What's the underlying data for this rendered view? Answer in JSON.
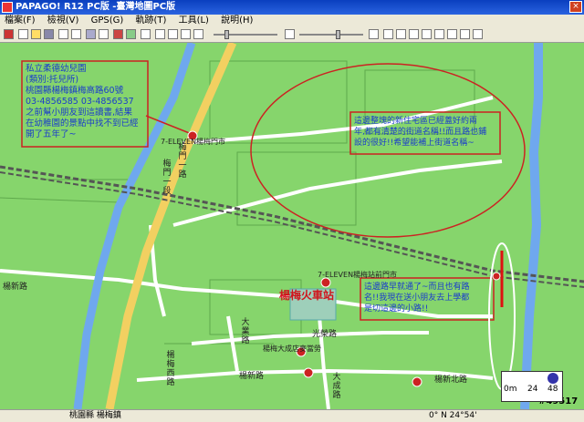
{
  "window": {
    "title": "PAPAGO! R12 PC版 -臺灣地圖PC版",
    "close_glyph": "×"
  },
  "menu": [
    "檔案(F)",
    "檢視(V)",
    "GPS(G)",
    "軌跡(T)",
    "工具(L)",
    "說明(H)"
  ],
  "map": {
    "roads": {
      "meimen_1": "梅門一路",
      "meimen_1_south": "梅門一段",
      "yangxin_road": "楊新路",
      "yangxin_north": "楊新北路",
      "da_cheng": "大成路",
      "guang_rong": "光榮路",
      "da_ye": "大業路",
      "yangmei_xizhou": "楊梅西路",
      "rail_road": "楊梅火車站"
    },
    "pois": {
      "seven_eleven_top": "7-ELEVEN楊梅門市",
      "seven_eleven_mid": "7-ELEVEN楊梅站前門市",
      "hotel": "楊梅大成店麥當勞",
      "station_title": "楊梅火車站"
    },
    "annotations": {
      "kindergarten": [
        "私立柔德幼兒園",
        "(類別:托兒所)",
        "桃園縣楊梅鎮梅高路60號",
        "03-4856585      03-4856537",
        "之前幫小朋友到這讀書,結果",
        "在幼稚園的景點中找不到已經",
        "開了五年了~"
      ],
      "new_homes": [
        "這邊整塊的新住宅區已經蓋好約兩",
        "年,都有清楚的街道名稱!!而且路也鋪",
        "設的很好!!希望能補上街道名稱~"
      ],
      "small_road": [
        "這邊路早就通了~而且也有路",
        "名!!我現在送小朋友去上學都",
        "是切這邊的小路!!"
      ]
    },
    "scale": {
      "left": "0m",
      "mid": "24",
      "right": "48"
    },
    "watermark": "#49517"
  },
  "status": {
    "address": "桃園縣 楊梅鎮",
    "coords": "0°  N 24°54'"
  },
  "colors": {
    "map_bg": "#7fd36a",
    "road_yellow": "#f5d56a",
    "river": "#6fa8ee",
    "note_red": "#cc2222"
  }
}
